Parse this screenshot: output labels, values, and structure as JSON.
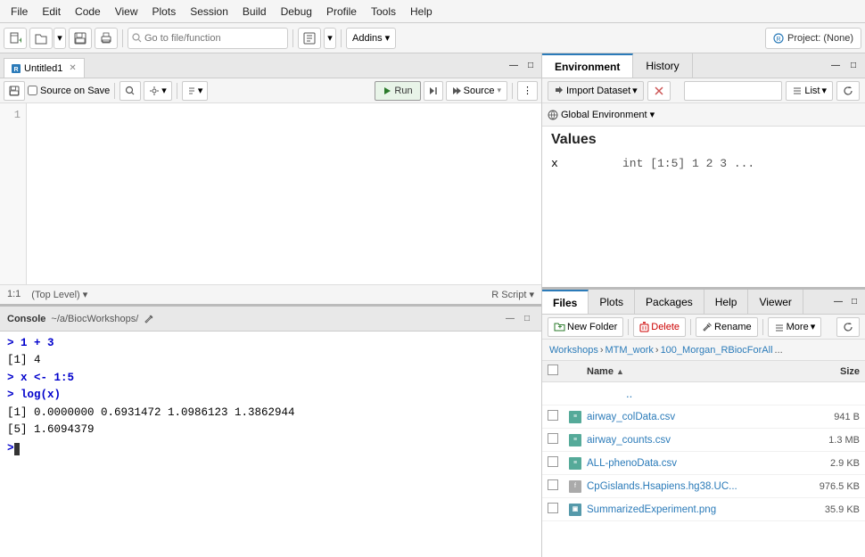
{
  "menubar": {
    "items": [
      "File",
      "Edit",
      "Code",
      "View",
      "Plots",
      "Session",
      "Build",
      "Debug",
      "Profile",
      "Tools",
      "Help"
    ]
  },
  "toolbar": {
    "goto_placeholder": "Go to file/function",
    "addins_label": "Addins",
    "project_label": "Project: (None)"
  },
  "editor": {
    "tab_title": "Untitled1",
    "source_on_save_label": "Source on Save",
    "run_label": "Run",
    "source_label": "Source",
    "line_numbers": [
      "1"
    ],
    "statusbar": {
      "position": "1:1",
      "context": "(Top Level)",
      "filetype": "R Script"
    }
  },
  "console": {
    "title": "Console",
    "path": "~/a/BiocWorkshops/",
    "lines": [
      {
        "type": "prompt",
        "text": "> 1 + 3"
      },
      {
        "type": "output",
        "text": "[1] 4"
      },
      {
        "type": "prompt",
        "text": "> x <- 1:5"
      },
      {
        "type": "prompt",
        "text": "> log(x)"
      },
      {
        "type": "output",
        "text": "[1] 0.0000000 0.6931472 1.0986123 1.3862944"
      },
      {
        "type": "output",
        "text": "[5] 1.6094379"
      }
    ],
    "cursor_prompt": ">"
  },
  "environment": {
    "tabs": [
      "Environment",
      "History"
    ],
    "active_tab": "Environment",
    "toolbar": {
      "import_dataset_label": "Import Dataset",
      "list_label": "List",
      "search_placeholder": ""
    },
    "global_env_label": "Global Environment",
    "section_title": "Values",
    "variables": [
      {
        "name": "x",
        "type": "int [1:5] 1 2 3 ...",
        "value": ""
      }
    ]
  },
  "files": {
    "tabs": [
      "Files",
      "Plots",
      "Packages",
      "Help",
      "Viewer"
    ],
    "active_tab": "Files",
    "toolbar": {
      "new_folder_label": "New Folder",
      "delete_label": "Delete",
      "rename_label": "Rename",
      "more_label": "More"
    },
    "breadcrumb": [
      "Workshops",
      "MTM_work",
      "100_Morgan_RBiocForAll",
      "..."
    ],
    "header": {
      "name_label": "Name",
      "size_label": "Size"
    },
    "files": [
      {
        "name": "..",
        "type": "up",
        "size": ""
      },
      {
        "name": "airway_colData.csv",
        "type": "csv",
        "size": "941 B"
      },
      {
        "name": "airway_counts.csv",
        "type": "csv",
        "size": "1.3 MB"
      },
      {
        "name": "ALL-phenoData.csv",
        "type": "csv",
        "size": "2.9 KB"
      },
      {
        "name": "CpGislands.Hsapiens.hg38.UC...",
        "type": "file",
        "size": "976.5 KB"
      },
      {
        "name": "SummarizedExperiment.png",
        "type": "png",
        "size": "35.9 KB"
      }
    ]
  }
}
